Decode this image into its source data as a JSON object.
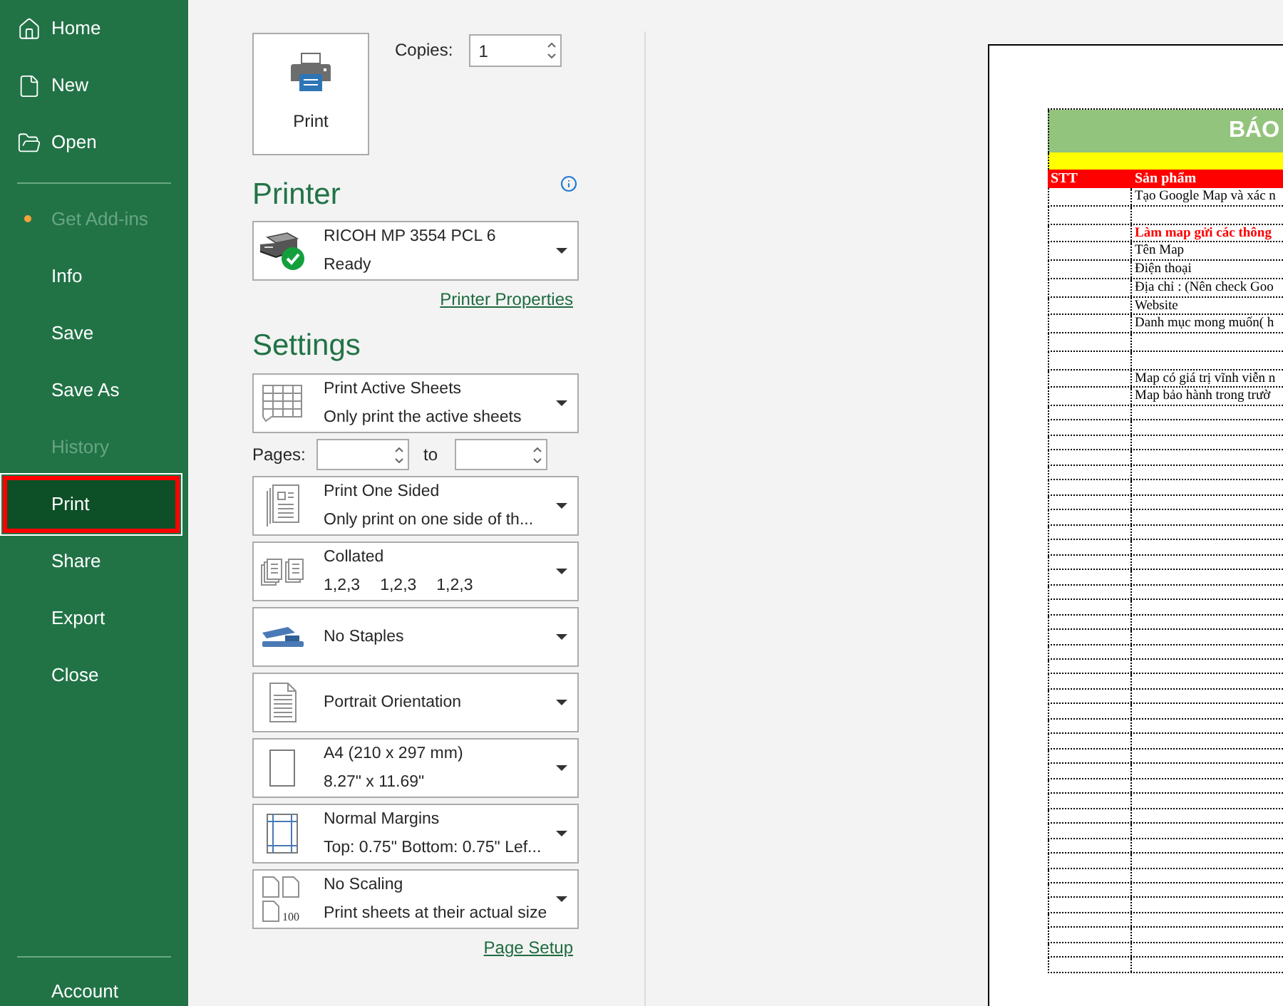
{
  "sidebar": {
    "top_items": [
      {
        "label": "Home"
      },
      {
        "label": "New"
      },
      {
        "label": "Open"
      }
    ],
    "items": [
      {
        "label": "Get Add-ins",
        "disabled": true,
        "selected": false,
        "notification": true
      },
      {
        "label": "Info",
        "disabled": false,
        "selected": false,
        "notification": false
      },
      {
        "label": "Save",
        "disabled": false,
        "selected": false,
        "notification": false
      },
      {
        "label": "Save As",
        "disabled": false,
        "selected": false,
        "notification": false
      },
      {
        "label": "History",
        "disabled": true,
        "selected": false,
        "notification": false
      },
      {
        "label": "Print",
        "disabled": false,
        "selected": true,
        "notification": false
      },
      {
        "label": "Share",
        "disabled": false,
        "selected": false,
        "notification": false
      },
      {
        "label": "Export",
        "disabled": false,
        "selected": false,
        "notification": false
      },
      {
        "label": "Close",
        "disabled": false,
        "selected": false,
        "notification": false
      }
    ],
    "bottom_items": [
      {
        "label": "Account"
      }
    ]
  },
  "print": {
    "button": "Print",
    "copies": {
      "label": "Copies:",
      "value": "1"
    }
  },
  "printer": {
    "heading": "Printer",
    "name": "RICOH MP 3554 PCL 6",
    "status": "Ready",
    "link": "Printer Properties"
  },
  "settings": {
    "heading": "Settings",
    "items": [
      {
        "kind": "dropdown",
        "title": "Print Active Sheets",
        "subtitle": "Only print the active sheets"
      },
      {
        "kind": "pages",
        "label": "Pages:",
        "to_label": "to"
      },
      {
        "kind": "dropdown",
        "title": "Print One Sided",
        "subtitle": "Only print on one side of th..."
      },
      {
        "kind": "dropdown",
        "title": "Collated",
        "sequence": [
          "1,2,3",
          "1,2,3",
          "1,2,3"
        ]
      },
      {
        "kind": "dropdown",
        "title": "No Staples"
      },
      {
        "kind": "dropdown",
        "title": "Portrait Orientation"
      },
      {
        "kind": "dropdown",
        "title": "A4 (210 x 297 mm)",
        "subtitle": "8.27\" x 11.69\""
      },
      {
        "kind": "dropdown",
        "title": "Normal Margins",
        "subtitle": "Top: 0.75\" Bottom: 0.75\" Lef..."
      },
      {
        "kind": "dropdown",
        "title": "No Scaling",
        "subtitle": "Print sheets at their actual size",
        "icon_caption": "100"
      }
    ],
    "link": "Page Setup"
  },
  "preview": {
    "title": "BÁO",
    "columns": [
      "STT",
      "Sản phẩm"
    ],
    "rows": [
      {
        "kind": "plain",
        "product": "Tạo Google Map và xác n"
      },
      {
        "kind": "blank"
      },
      {
        "kind": "note",
        "product": "Làm map gửi các thông"
      },
      {
        "kind": "plain",
        "product": "Tên Map"
      },
      {
        "kind": "plain",
        "product": "Điện thoại"
      },
      {
        "kind": "plain",
        "product": "Địa chỉ : (Nên check Goo"
      },
      {
        "kind": "plain",
        "product": "Website"
      },
      {
        "kind": "plain",
        "product": "Danh mục mong muốn( h"
      },
      {
        "kind": "blank"
      },
      {
        "kind": "blank"
      },
      {
        "kind": "plain",
        "product": "Map có giá trị vĩnh viễn n"
      },
      {
        "kind": "plain",
        "product": "Map bảo hành trong trườ"
      }
    ]
  }
}
